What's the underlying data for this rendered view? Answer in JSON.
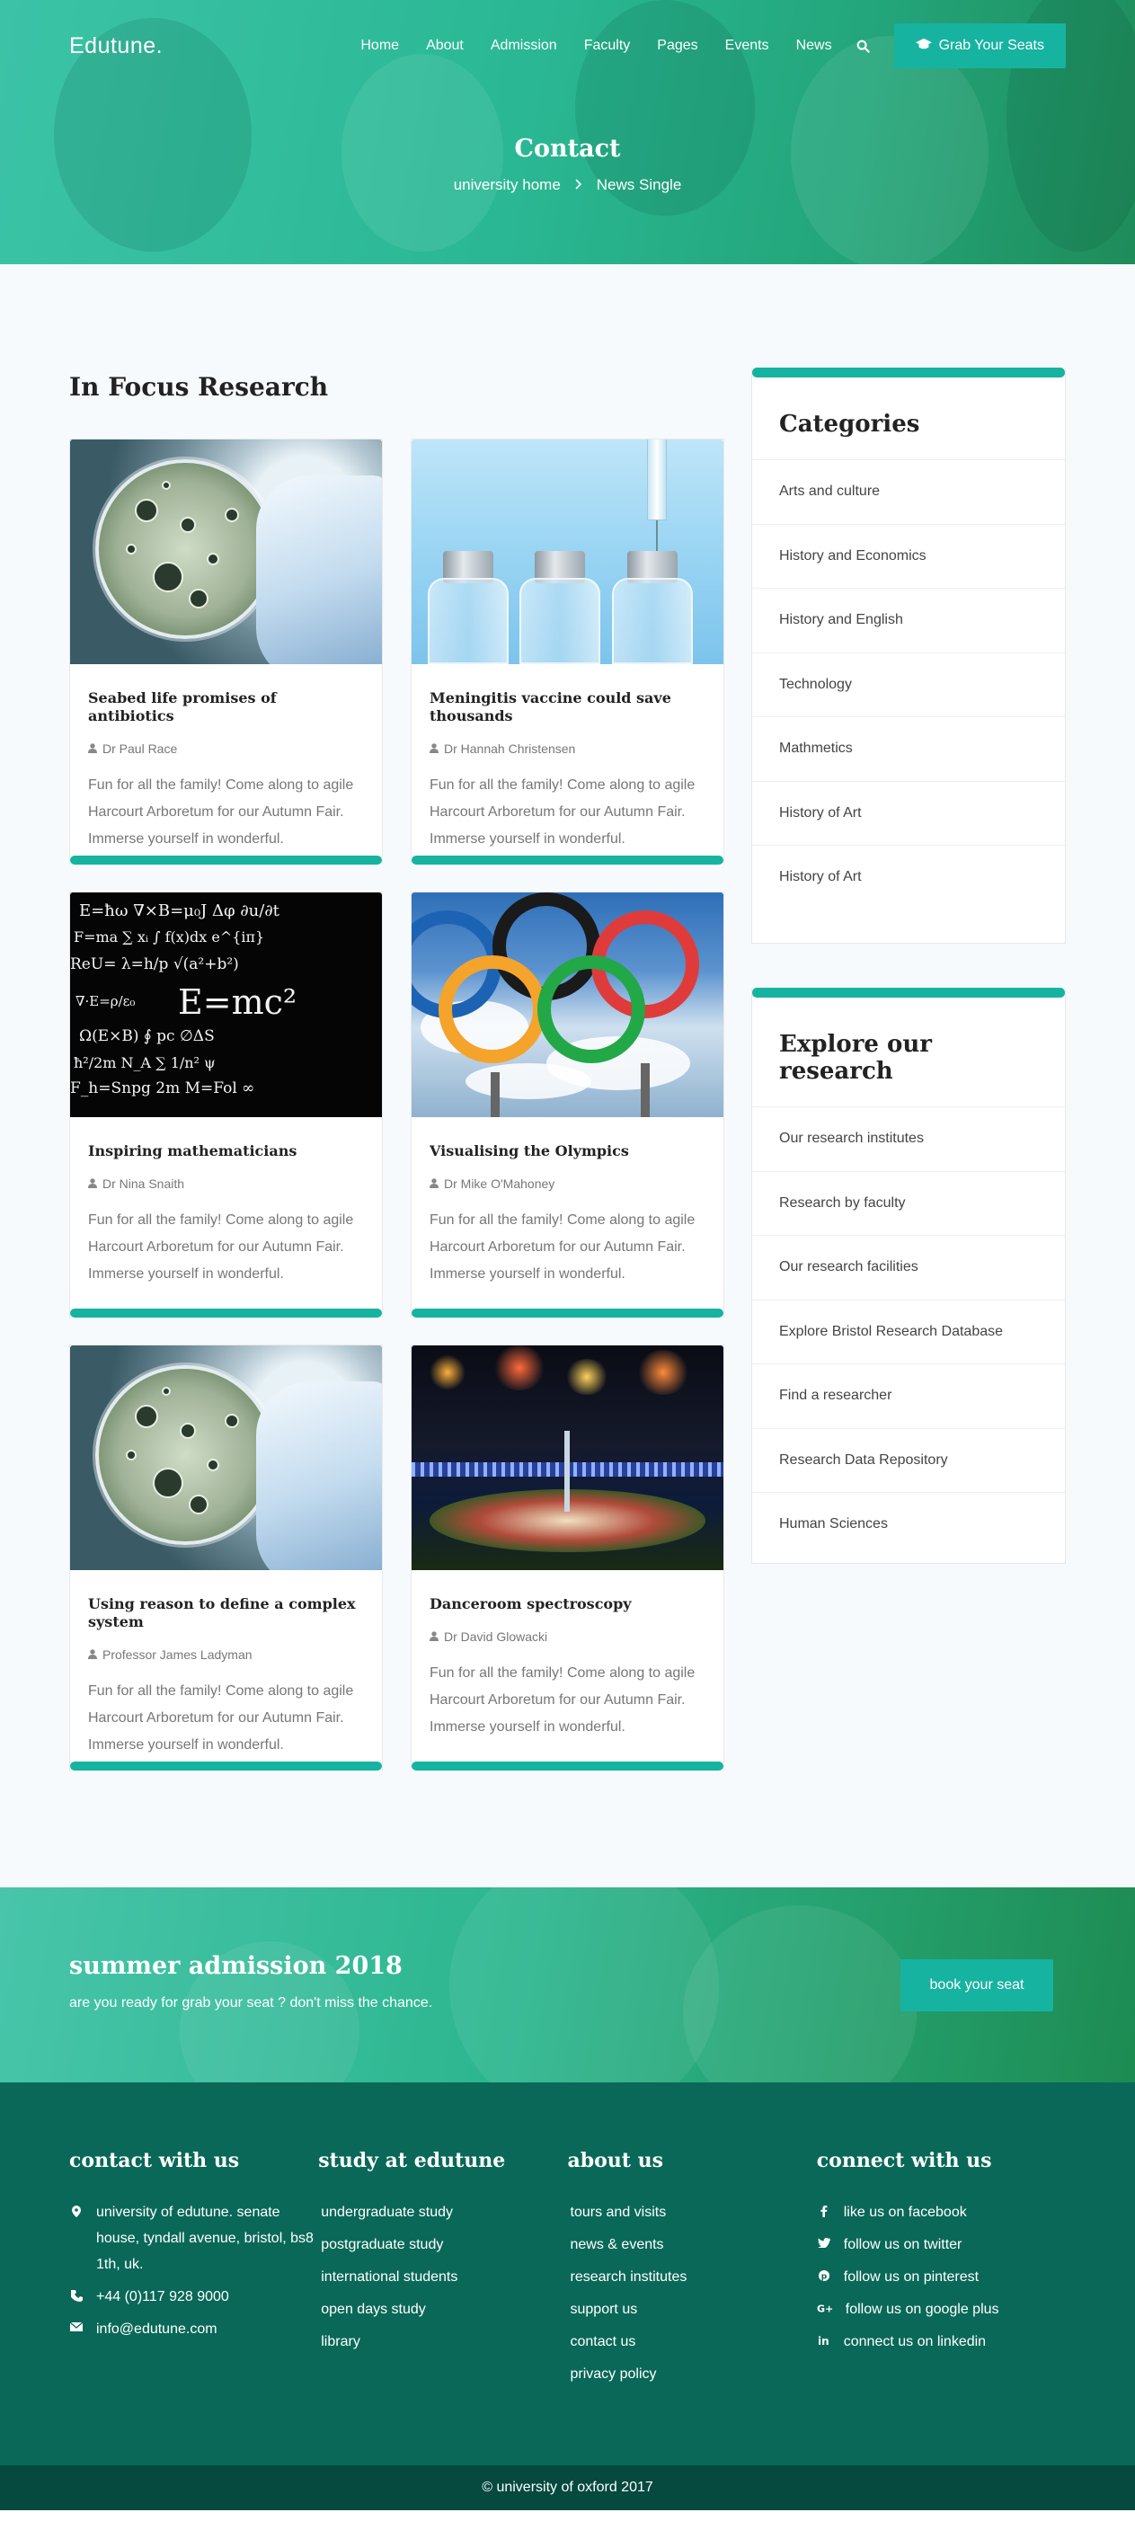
{
  "header": {
    "logo": "Edutune.",
    "menu": [
      "Home",
      "About",
      "Admission",
      "Faculty",
      "Pages",
      "Events",
      "News"
    ],
    "cta_label": "Grab Your Seats",
    "title": "Contact",
    "breadcrumb_home": "university home",
    "breadcrumb_current": "News Single",
    "accent": "#17b3a1"
  },
  "main": {
    "section_title": "In Focus Research",
    "cards": [
      {
        "title": "Seabed life promises of antibiotics",
        "author": "Dr Paul Race",
        "excerpt": "Fun for all the family! Come along to agile Harcourt Arboretum for our Autumn Fair. Immerse yourself in wonderful.",
        "image": "petri-dish"
      },
      {
        "title": "Meningitis vaccine could save thousands",
        "author": "Dr Hannah Christensen",
        "excerpt": "Fun for all the family! Come along to agile Harcourt Arboretum for our Autumn Fair. Immerse yourself in wonderful.",
        "image": "vaccine-vials"
      },
      {
        "title": "Inspiring mathematicians",
        "author": "Dr Nina Snaith",
        "excerpt": "Fun for all the family! Come along to agile Harcourt Arboretum for our Autumn Fair. Immerse yourself in wonderful.",
        "image": "blackboard-equations"
      },
      {
        "title": "Visualising the Olympics",
        "author": "Dr Mike O'Mahoney",
        "excerpt": "Fun for all the family! Come along to agile Harcourt Arboretum for our Autumn Fair. Immerse yourself in wonderful.",
        "image": "olympic-rings"
      },
      {
        "title": "Using reason to define a complex system",
        "author": "Professor James Ladyman",
        "excerpt": "Fun for all the family! Come along to agile Harcourt Arboretum for our Autumn Fair. Immerse yourself in wonderful.",
        "image": "petri-dish"
      },
      {
        "title": "Danceroom spectroscopy",
        "author": "Dr David Glowacki",
        "excerpt": "Fun for all the family! Come along to agile Harcourt Arboretum for our Autumn Fair. Immerse yourself in wonderful.",
        "image": "stadium-fireworks"
      }
    ]
  },
  "sidebar": {
    "categories_title": "Categories",
    "categories": [
      "Arts and culture",
      "History and Economics",
      "History and English",
      "Technology",
      "Mathmetics",
      "History of Art",
      "History of Art"
    ],
    "research_title": "Explore our research",
    "research": [
      "Our research institutes",
      "Research by faculty",
      "Our research facilities",
      "Explore Bristol Research Database",
      "Find a researcher",
      "Research Data Repository",
      "Human Sciences"
    ]
  },
  "admission": {
    "title": "summer admission 2018",
    "subtitle": "are you ready for grab your seat ? don't miss the chance.",
    "button": "book your seat"
  },
  "footer": {
    "contact_title": "contact with us",
    "address": "university of edutune. senate house, tyndall avenue, bristol, bs8 1th, uk.",
    "phone": "+44 (0)117 928 9000",
    "email": "info@edutune.com",
    "study_title": "study at edutune",
    "study_links": [
      "undergraduate study",
      "postgraduate study",
      "international students",
      "open days study",
      "library"
    ],
    "about_title": "about us",
    "about_links": [
      "tours and visits",
      "news & events",
      "research institutes",
      "support us",
      "contact us",
      "privacy policy"
    ],
    "connect_title": "connect with us",
    "social": [
      {
        "label": "like us on facebook",
        "icon": "facebook-icon"
      },
      {
        "label": "follow us on twitter",
        "icon": "twitter-icon"
      },
      {
        "label": "follow us on pinterest",
        "icon": "pinterest-icon"
      },
      {
        "label": "follow us on google plus",
        "icon": "google-plus-icon"
      },
      {
        "label": "connect us on linkedin",
        "icon": "linkedin-icon"
      }
    ],
    "copyright": "© university of oxford 2017"
  }
}
